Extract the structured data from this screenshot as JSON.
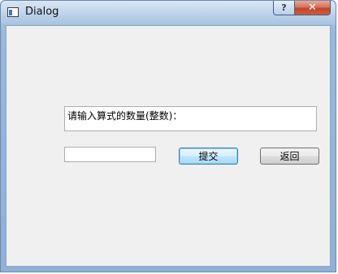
{
  "window": {
    "title": "Dialog"
  },
  "caption_buttons": {
    "help_label": "?",
    "close_label": "✕"
  },
  "form": {
    "prompt": "请输入算式的数量(整数)：",
    "count_input_value": "",
    "submit_label": "提交",
    "back_label": "返回"
  },
  "colors": {
    "accent_border": "#3c7fb1",
    "close_button": "#c2452a",
    "client_background": "#f0f0f0"
  }
}
